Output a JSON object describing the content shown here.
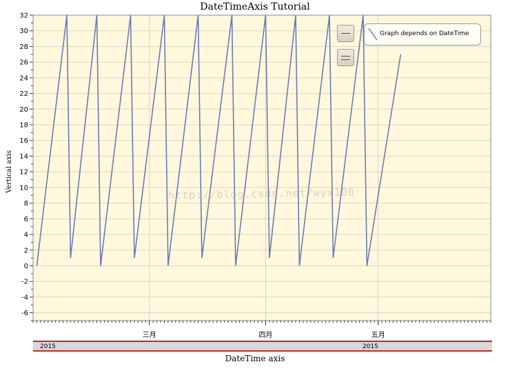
{
  "watermark": "http://blog.csdn.net/wyx100",
  "zoom_buttons": [
    {
      "icon": "zoom-in-icon"
    },
    {
      "icon": "zoom-out-icon"
    }
  ],
  "colors": {
    "plot_background": "#fff8dc",
    "series": "#6b7ab8",
    "grid": "#d9d5c6",
    "band_border": "#c0282d"
  },
  "chart_data": {
    "type": "line",
    "title": "DateTimeAxis Tutorial",
    "xlabel": "DateTime axis",
    "ylabel": "Vertical axis",
    "x_axis": "datetime",
    "xlim": [
      "2015-01-29",
      "2015-05-31"
    ],
    "ylim": [
      -7,
      32
    ],
    "y_ticks": [
      -6,
      -4,
      -2,
      0,
      2,
      4,
      6,
      8,
      10,
      12,
      14,
      16,
      18,
      20,
      22,
      24,
      26,
      28,
      30,
      32
    ],
    "x_tick_labels": [
      {
        "date": "2015-03-01",
        "label": "三月"
      },
      {
        "date": "2015-04-01",
        "label": "四月"
      },
      {
        "date": "2015-05-01",
        "label": "五月"
      }
    ],
    "year_band": [
      {
        "date": "2015-01-31",
        "label": "2015"
      },
      {
        "date": "2015-04-19",
        "label": "2015"
      }
    ],
    "grid": true,
    "legend": "top-right",
    "series": [
      {
        "name": "Graph depends on DateTime",
        "points": [
          [
            "2015-01-30",
            0
          ],
          [
            "2015-02-07",
            32
          ],
          [
            "2015-02-08",
            1
          ],
          [
            "2015-02-15",
            32
          ],
          [
            "2015-02-16",
            0
          ],
          [
            "2015-02-24",
            32
          ],
          [
            "2015-02-25",
            1
          ],
          [
            "2015-03-05",
            32
          ],
          [
            "2015-03-06",
            0
          ],
          [
            "2015-03-14",
            32
          ],
          [
            "2015-03-15",
            1
          ],
          [
            "2015-03-23",
            32
          ],
          [
            "2015-03-24",
            0
          ],
          [
            "2015-04-01",
            32
          ],
          [
            "2015-04-02",
            1
          ],
          [
            "2015-04-09",
            32
          ],
          [
            "2015-04-10",
            0
          ],
          [
            "2015-04-18",
            32
          ],
          [
            "2015-04-19",
            1
          ],
          [
            "2015-04-27",
            32
          ],
          [
            "2015-04-28",
            0
          ],
          [
            "2015-05-07",
            27
          ]
        ]
      }
    ]
  }
}
